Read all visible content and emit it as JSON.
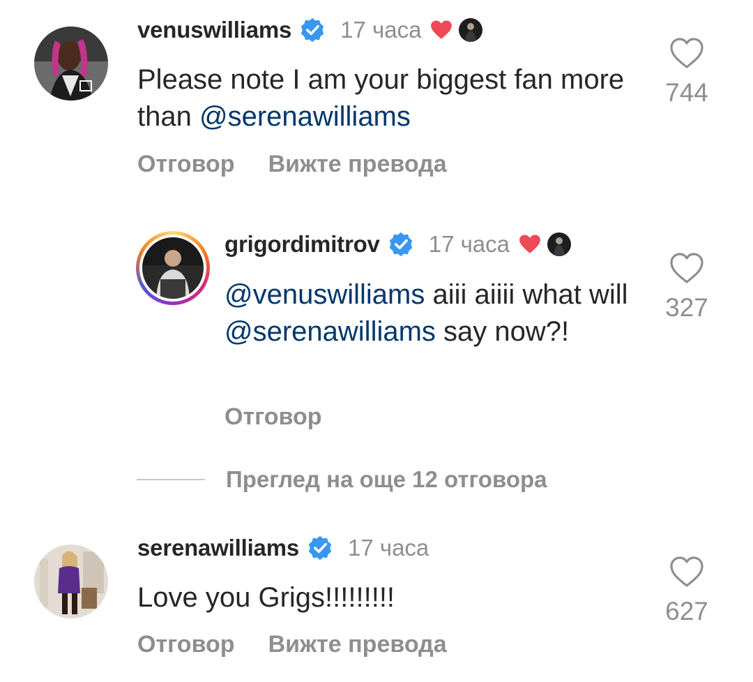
{
  "comments": [
    {
      "username": "venuswilliams",
      "time": "17 часа",
      "text_plain": "Please note I am your biggest fan more than ",
      "text_mention": "@serenawilliams",
      "likes": "744",
      "reply_label": "Отговор",
      "translate_label": "Вижте превода"
    },
    {
      "username": "grigordimitrov",
      "time": "17 часа",
      "mention_1": "@venuswilliams",
      "text_1": " aiii aiiii what will ",
      "mention_2": "@serenawilliams",
      "text_2": " say now?!",
      "likes": "327",
      "reply_label": "Отговор"
    },
    {
      "username": "serenawilliams",
      "time": "17 часа",
      "text_plain": "Love you Grigs!!!!!!!!!",
      "likes": "627",
      "reply_label": "Отговор",
      "translate_label": "Вижте превода"
    }
  ],
  "more_replies_label": "Преглед на още 12 отговора",
  "colors": {
    "verified": "#3897f0",
    "heart": "#ed4956",
    "mention": "#00376b",
    "secondary_text": "#8e8e8e"
  },
  "icons": {
    "verified": "verified-badge-icon",
    "liked_by_author": "heart-icon",
    "like": "heart-outline-icon"
  }
}
